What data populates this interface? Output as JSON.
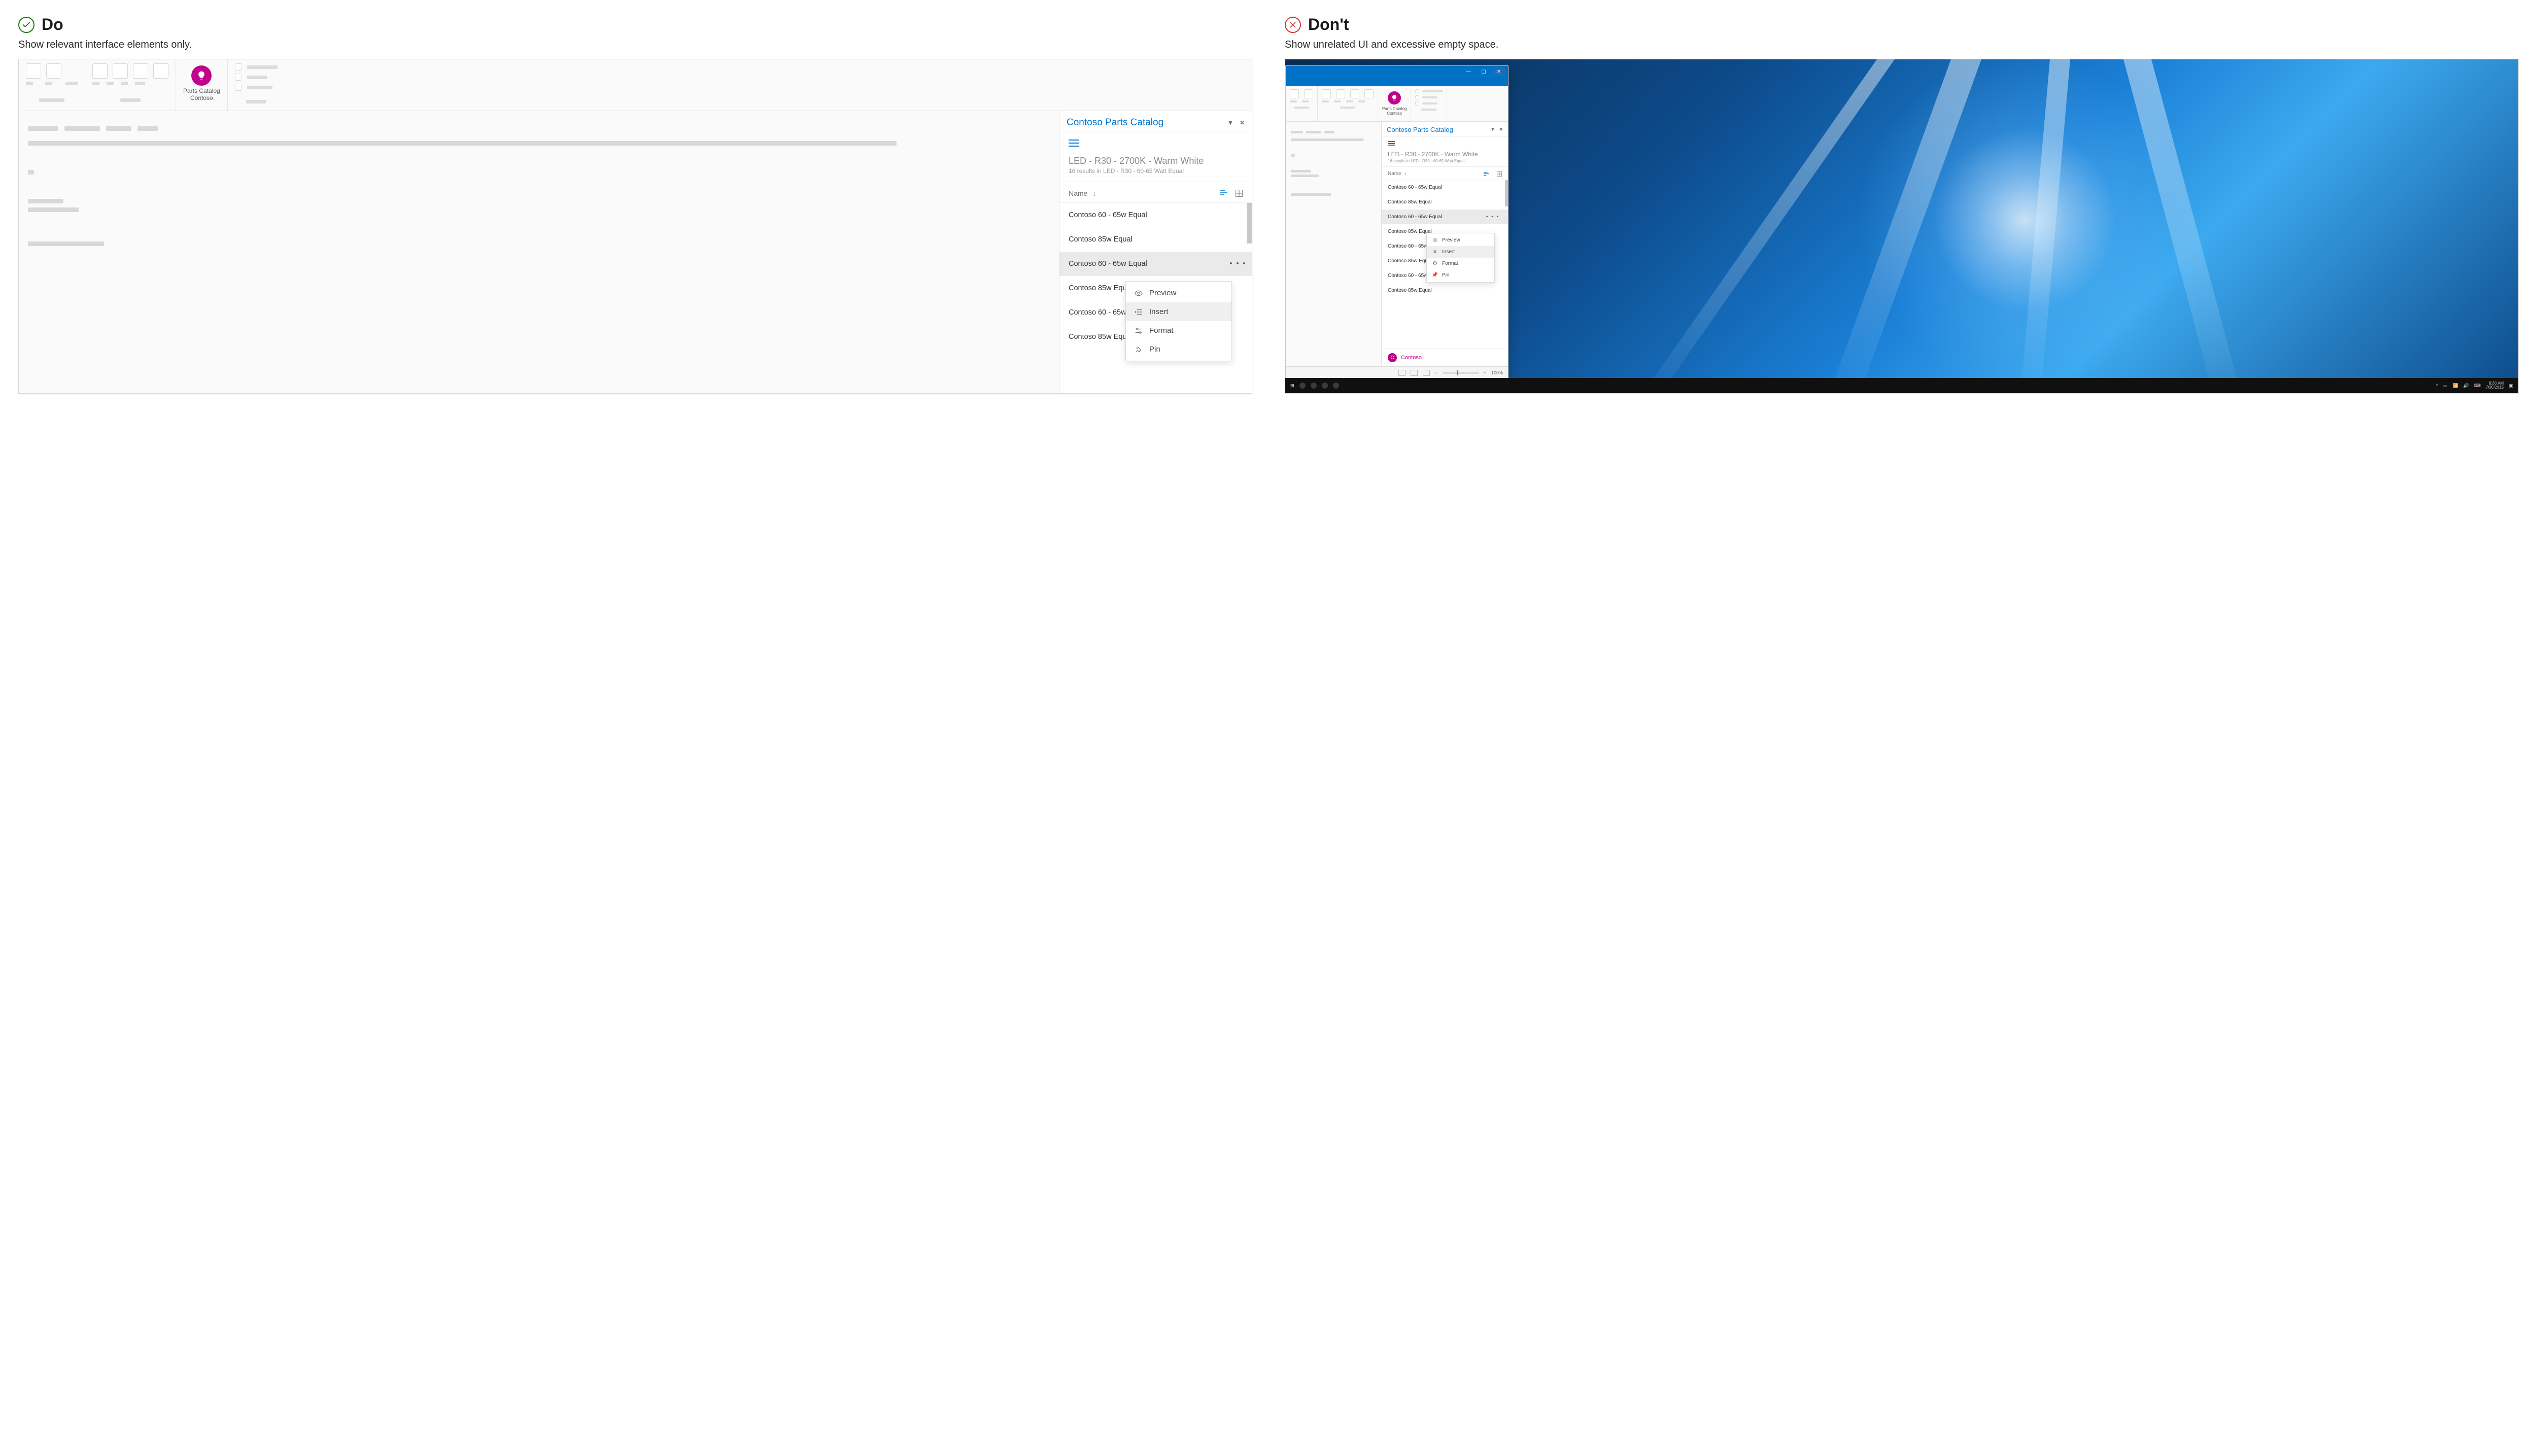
{
  "do": {
    "heading": "Do",
    "subtitle": "Show relevant interface elements only."
  },
  "dont": {
    "heading": "Don't",
    "subtitle": "Show unrelated UI and excessive empty space."
  },
  "ribbon_button": {
    "line1": "Parts Catalog",
    "line2": "Contoso"
  },
  "pane": {
    "title": "Contoso Parts Catalog",
    "search_title": "LED - R30 - 2700K - Warm White",
    "search_sub": "16 results in LED - R30 - 60-65 Watt Equal",
    "sort_label": "Name",
    "items": [
      "Contoso 60 - 65w Equal",
      "Contoso 85w Equal",
      "Contoso 60 - 65w Equal",
      "Contoso 85w Equal",
      "Contoso 60 - 65w Equal",
      "Contoso 85w Equal",
      "Contoso 60 - 65w Equal",
      "Contoso 85w Equal"
    ],
    "selected_index": 2
  },
  "context_menu": {
    "items": [
      "Preview",
      "Insert",
      "Format",
      "Pin"
    ],
    "highlighted_index": 1
  },
  "footer": {
    "avatar_letter": "C",
    "brand": "Contoso"
  },
  "statusbar": {
    "zoom": "100%"
  },
  "taskbar": {
    "time": "6:30 AM",
    "date": "7/30/2015"
  }
}
